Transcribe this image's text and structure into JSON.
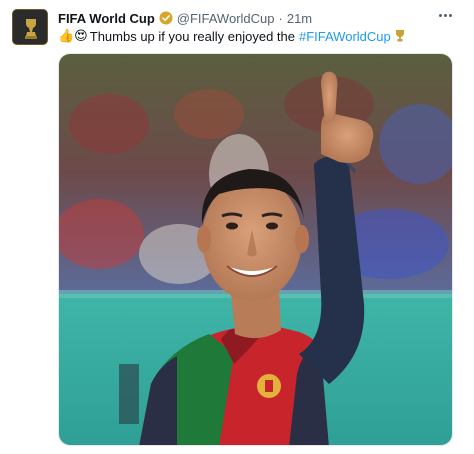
{
  "tweet": {
    "author_name": "FIFA World Cup",
    "handle": "@FIFAWorldCup",
    "separator": "·",
    "time": "21m",
    "emojis": "👍😍",
    "text": "Thumbs up if you really enjoyed the",
    "hashtag": "#FIFAWorldCup"
  },
  "icons": {
    "avatar": "fifa-world-cup-logo",
    "verified": "verified-badge-icon",
    "trophy": "trophy-emoji-icon",
    "more": "more-options-icon"
  },
  "colors": {
    "link": "#1d9bf0",
    "verified_badge": "#d7a52a",
    "secondary_text": "#536471"
  }
}
